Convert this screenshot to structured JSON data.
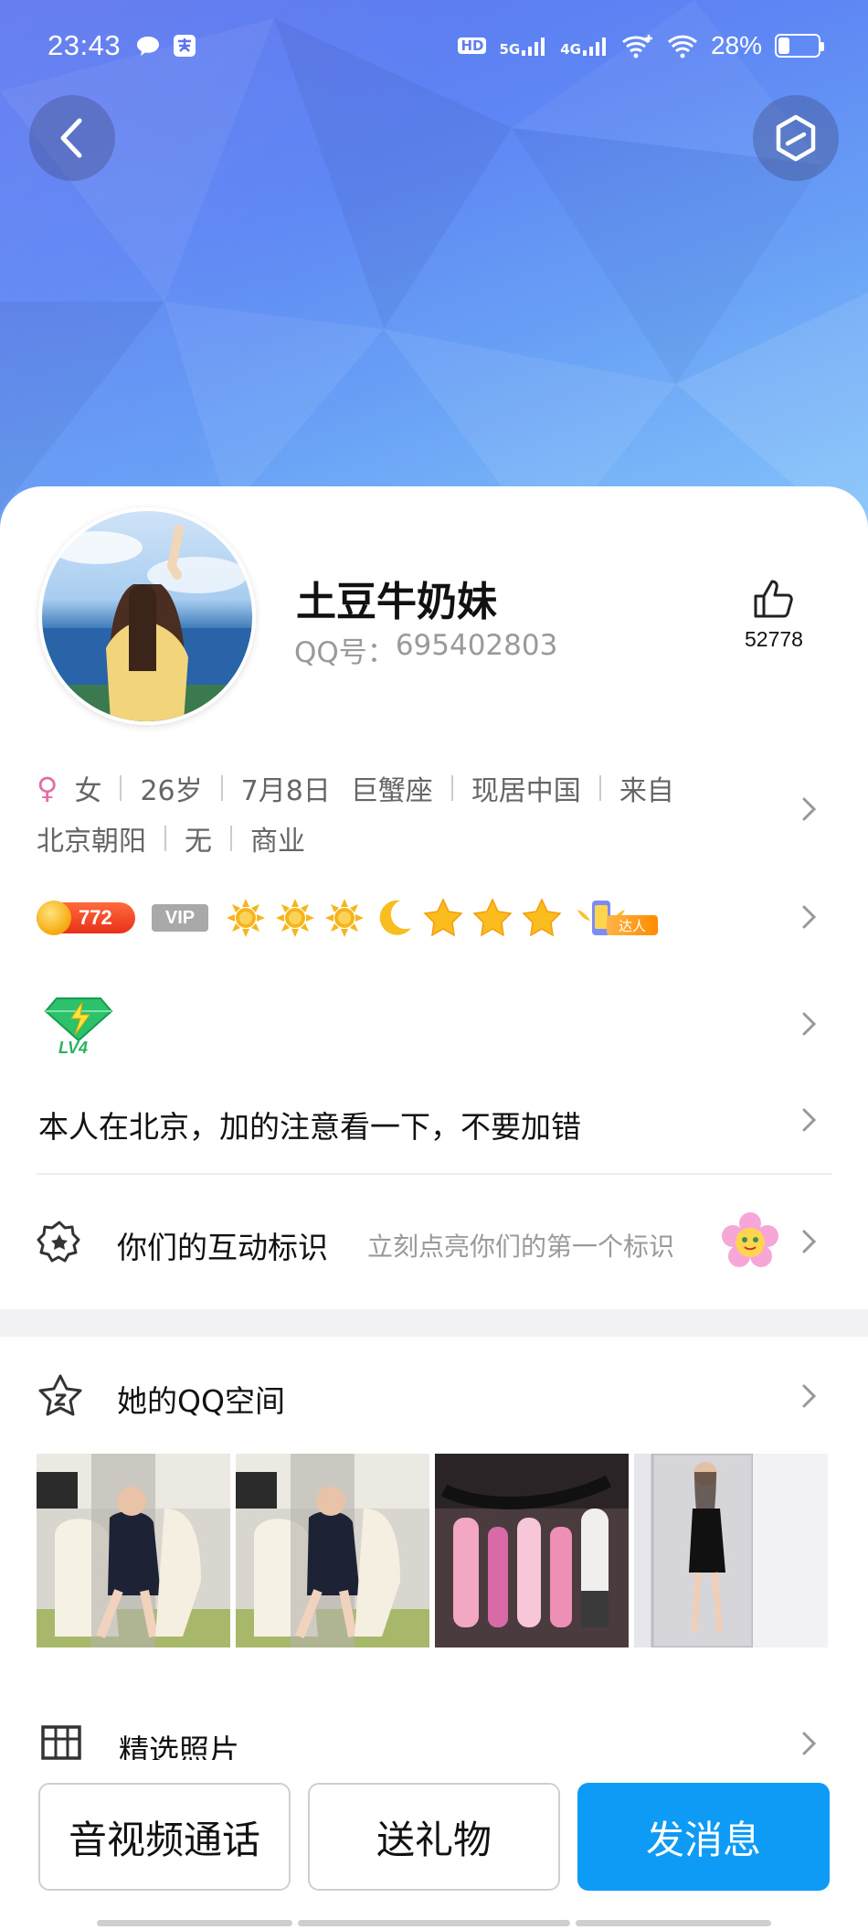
{
  "status_bar": {
    "time": "23:43",
    "hd_label": "HD",
    "sim1_label": "5G",
    "sim2_label": "4G",
    "battery_percent": "28%",
    "battery_level": 0.28
  },
  "header": {
    "back_icon": "chevron-left-icon",
    "settings_icon": "hexagon-icon"
  },
  "profile": {
    "nickname": "土豆牛奶妹",
    "qq_label": "QQ号：",
    "qq_number": "695402803",
    "like_count": "52778",
    "gender_symbol": "♀",
    "gender": "女",
    "age": "26岁",
    "birthday": "7月8日",
    "zodiac": "巨蟹座",
    "location": "现居中国",
    "hometown_prefix": "来自",
    "hometown": "北京朝阳",
    "field1": "无",
    "profession": "商业",
    "coin_level": "772",
    "vip_label": "VIP",
    "daren_label": "达人",
    "game_level_label": "LV4",
    "signature": "本人在北京，加的注意看一下，不要加错"
  },
  "interaction": {
    "title": "你们的互动标识",
    "subtitle": "立刻点亮你们的第一个标识"
  },
  "qzone": {
    "title": "她的QQ空间"
  },
  "featured": {
    "title": "精选照片"
  },
  "actions": {
    "call_label": "音视频通话",
    "gift_label": "送礼物",
    "message_label": "发消息"
  },
  "colors": {
    "primary_button": "#0d9bf5",
    "banner_start": "#5b73ee",
    "banner_end": "#85c6fb",
    "coin_badge": "#e8301a",
    "gender_icon": "#e06fa5"
  }
}
